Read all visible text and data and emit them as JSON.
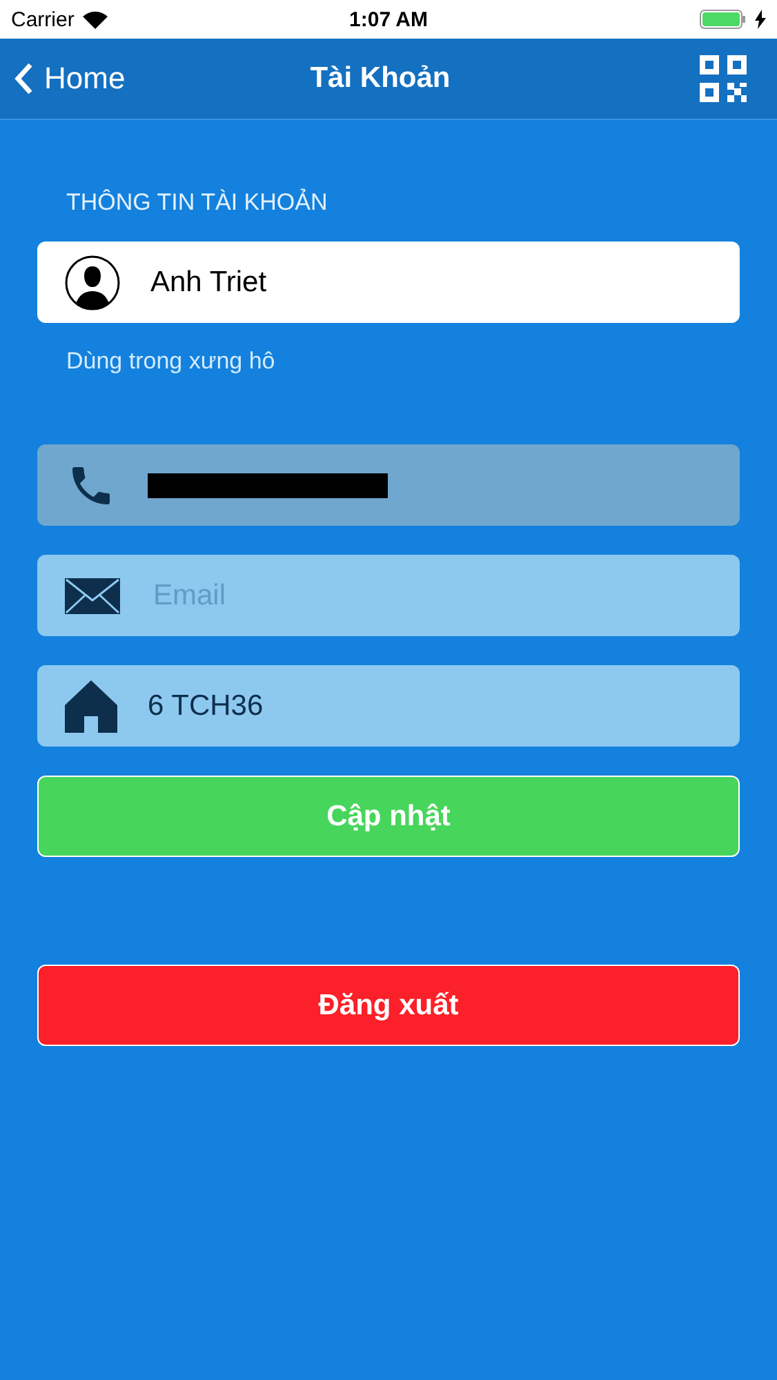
{
  "status_bar": {
    "carrier": "Carrier",
    "time": "1:07 AM",
    "battery": {
      "level": 1
    }
  },
  "nav": {
    "back": "Home",
    "title": "Tài Khoản"
  },
  "section_label": "THÔNG TIN TÀI KHOẢN",
  "name_field": {
    "value": "Anh Triet"
  },
  "name_hint": "Dùng trong xưng hô",
  "fields": [
    {
      "kind": "phone",
      "disabled": true,
      "redacted": true
    },
    {
      "kind": "email",
      "disabled": false,
      "placeholder": "Email"
    },
    {
      "kind": "address",
      "disabled": false,
      "value": "6 TCH36"
    }
  ],
  "buttons": [
    {
      "kind": "update",
      "label": "Cập nhật"
    },
    {
      "kind": "logout",
      "label": "Đăng xuất"
    }
  ]
}
